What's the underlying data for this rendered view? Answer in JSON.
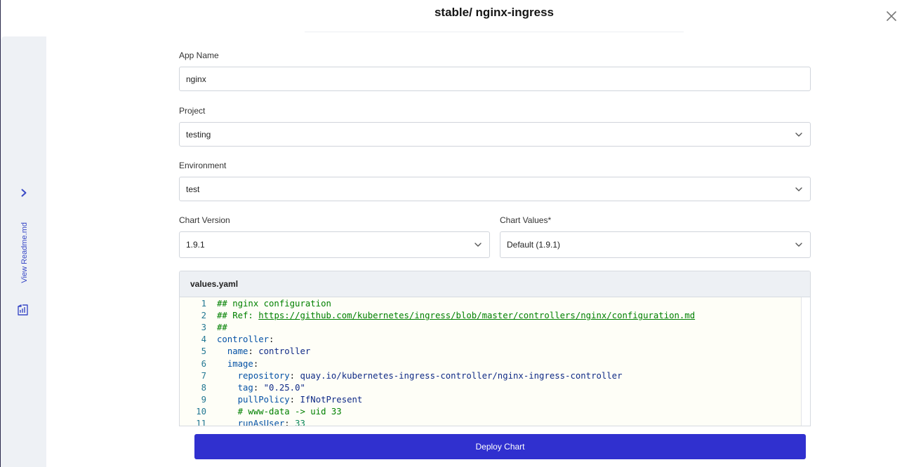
{
  "modal": {
    "title": "stable/ nginx-ingress"
  },
  "sidebar": {
    "readme_label": "View Readme.md"
  },
  "form": {
    "app_name": {
      "label": "App Name",
      "value": "nginx"
    },
    "project": {
      "label": "Project",
      "value": "testing"
    },
    "environment": {
      "label": "Environment",
      "value": "test"
    },
    "chart_version": {
      "label": "Chart Version",
      "value": "1.9.1"
    },
    "chart_values": {
      "label": "Chart Values*",
      "value": "Default (1.9.1)"
    }
  },
  "editor": {
    "filename": "values.yaml",
    "lines": [
      {
        "n": "1",
        "indent": "",
        "key": "",
        "sep": "",
        "val": "",
        "comment": "## nginx configuration",
        "link": ""
      },
      {
        "n": "2",
        "indent": "",
        "key": "",
        "sep": "",
        "val": "",
        "comment": "## Ref: ",
        "link": "https://github.com/kubernetes/ingress/blob/master/controllers/nginx/configuration.md"
      },
      {
        "n": "3",
        "indent": "",
        "key": "",
        "sep": "",
        "val": "",
        "comment": "##",
        "link": ""
      },
      {
        "n": "4",
        "indent": "",
        "key": "controller",
        "sep": ":",
        "val": "",
        "comment": "",
        "link": ""
      },
      {
        "n": "5",
        "indent": "  ",
        "key": "name",
        "sep": ": ",
        "val": "controller",
        "comment": "",
        "link": ""
      },
      {
        "n": "6",
        "indent": "  ",
        "key": "image",
        "sep": ":",
        "val": "",
        "comment": "",
        "link": ""
      },
      {
        "n": "7",
        "indent": "    ",
        "key": "repository",
        "sep": ": ",
        "val": "quay.io/kubernetes-ingress-controller/nginx-ingress-controller",
        "comment": "",
        "link": ""
      },
      {
        "n": "8",
        "indent": "    ",
        "key": "tag",
        "sep": ": ",
        "val": "\"0.25.0\"",
        "comment": "",
        "link": ""
      },
      {
        "n": "9",
        "indent": "    ",
        "key": "pullPolicy",
        "sep": ": ",
        "val": "IfNotPresent",
        "comment": "",
        "link": ""
      },
      {
        "n": "10",
        "indent": "    ",
        "key": "",
        "sep": "",
        "val": "",
        "comment": "# www-data -> uid 33",
        "link": ""
      },
      {
        "n": "11",
        "indent": "    ",
        "key": "runAsUser",
        "sep": ": ",
        "val": "33",
        "comment": "",
        "link": ""
      }
    ]
  },
  "actions": {
    "deploy_label": "Deploy Chart"
  },
  "icons": {
    "close": "close-icon",
    "chevron": "chevron-right-icon",
    "readme": "document-icon",
    "dropdown": "chevron-down-icon"
  },
  "colors": {
    "primary": "#3030cf",
    "accent_text": "#3a4ac6"
  }
}
